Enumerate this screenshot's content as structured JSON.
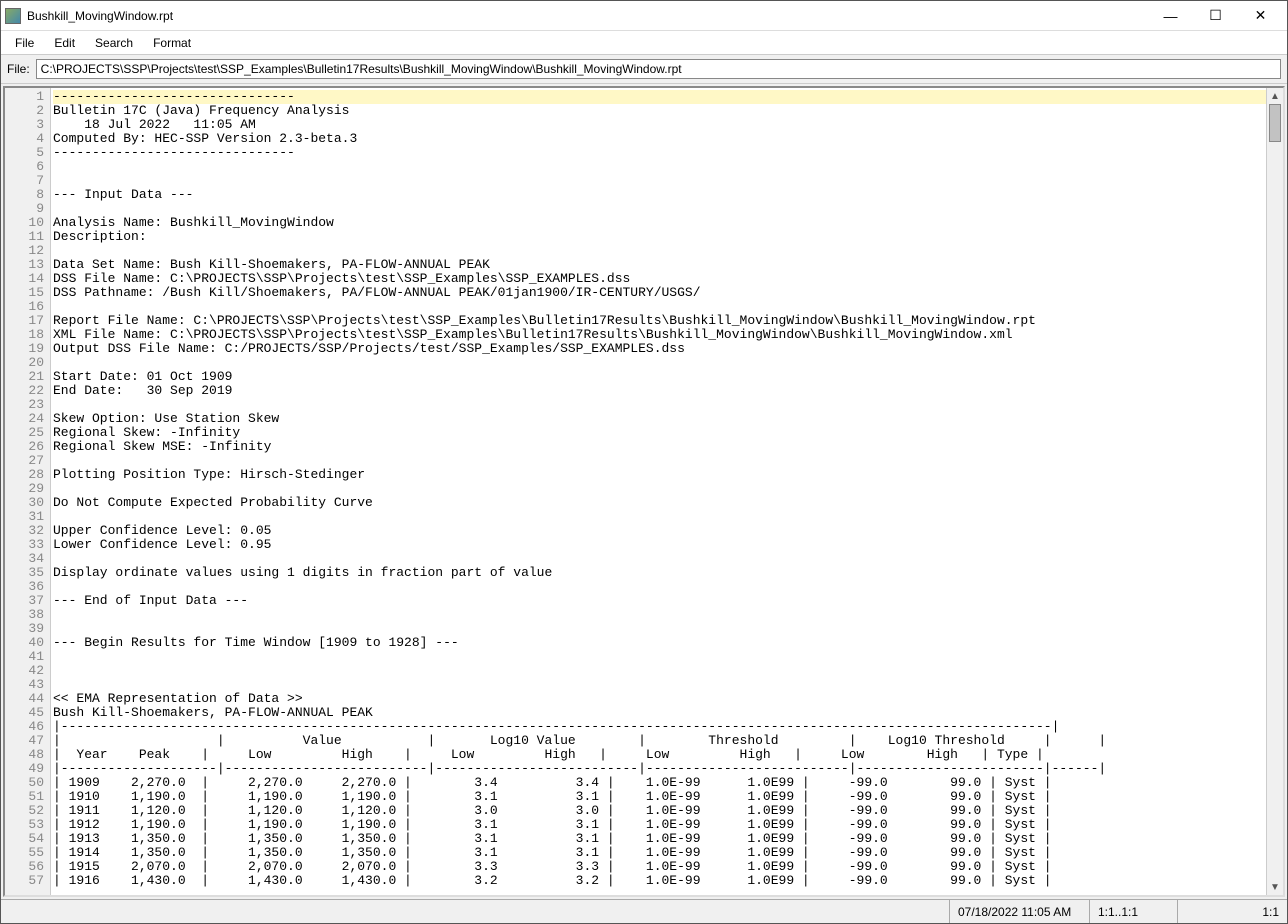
{
  "window": {
    "title": "Bushkill_MovingWindow.rpt"
  },
  "menu": {
    "file": "File",
    "edit": "Edit",
    "search": "Search",
    "format": "Format"
  },
  "filebar": {
    "label": "File:",
    "path": "C:\\PROJECTS\\SSP\\Projects\\test\\SSP_Examples\\Bulletin17Results\\Bushkill_MovingWindow\\Bushkill_MovingWindow.rpt"
  },
  "statusbar": {
    "datetime": "07/18/2022 11:05 AM",
    "selection": "1:1..1:1",
    "position": "1:1"
  },
  "lines": [
    "-------------------------------",
    "Bulletin 17C (Java) Frequency Analysis",
    "    18 Jul 2022   11:05 AM",
    "Computed By: HEC-SSP Version 2.3-beta.3",
    "-------------------------------",
    "",
    "",
    "--- Input Data ---",
    "",
    "Analysis Name: Bushkill_MovingWindow",
    "Description: ",
    "",
    "Data Set Name: Bush Kill-Shoemakers, PA-FLOW-ANNUAL PEAK",
    "DSS File Name: C:\\PROJECTS\\SSP\\Projects\\test\\SSP_Examples\\SSP_EXAMPLES.dss",
    "DSS Pathname: /Bush Kill/Shoemakers, PA/FLOW-ANNUAL PEAK/01jan1900/IR-CENTURY/USGS/",
    "",
    "Report File Name: C:\\PROJECTS\\SSP\\Projects\\test\\SSP_Examples\\Bulletin17Results\\Bushkill_MovingWindow\\Bushkill_MovingWindow.rpt",
    "XML File Name: C:\\PROJECTS\\SSP\\Projects\\test\\SSP_Examples\\Bulletin17Results\\Bushkill_MovingWindow\\Bushkill_MovingWindow.xml",
    "Output DSS File Name: C:/PROJECTS/SSP/Projects/test/SSP_Examples/SSP_EXAMPLES.dss",
    "",
    "Start Date: 01 Oct 1909",
    "End Date:   30 Sep 2019",
    "",
    "Skew Option: Use Station Skew",
    "Regional Skew: -Infinity",
    "Regional Skew MSE: -Infinity",
    "",
    "Plotting Position Type: Hirsch-Stedinger",
    "",
    "Do Not Compute Expected Probability Curve",
    "",
    "Upper Confidence Level: 0.05",
    "Lower Confidence Level: 0.95",
    "",
    "Display ordinate values using 1 digits in fraction part of value",
    "",
    "--- End of Input Data ---",
    "",
    "",
    "--- Begin Results for Time Window [1909 to 1928] ---",
    "",
    "",
    "",
    "<< EMA Representation of Data >>",
    "Bush Kill-Shoemakers, PA-FLOW-ANNUAL PEAK",
    "|-------------------------------------------------------------------------------------------------------------------------------|",
    "|                    |          Value           |       Log10 Value        |        Threshold         |    Log10 Threshold     |      |",
    "|  Year    Peak    |     Low         High    |     Low         High   |     Low         High   |     Low        High   | Type |",
    "|--------------------|--------------------------|--------------------------|--------------------------|------------------------|------|",
    "| 1909    2,270.0  |     2,270.0     2,270.0 |        3.4          3.4 |    1.0E-99      1.0E99 |     -99.0        99.0 | Syst |",
    "| 1910    1,190.0  |     1,190.0     1,190.0 |        3.1          3.1 |    1.0E-99      1.0E99 |     -99.0        99.0 | Syst |",
    "| 1911    1,120.0  |     1,120.0     1,120.0 |        3.0          3.0 |    1.0E-99      1.0E99 |     -99.0        99.0 | Syst |",
    "| 1912    1,190.0  |     1,190.0     1,190.0 |        3.1          3.1 |    1.0E-99      1.0E99 |     -99.0        99.0 | Syst |",
    "| 1913    1,350.0  |     1,350.0     1,350.0 |        3.1          3.1 |    1.0E-99      1.0E99 |     -99.0        99.0 | Syst |",
    "| 1914    1,350.0  |     1,350.0     1,350.0 |        3.1          3.1 |    1.0E-99      1.0E99 |     -99.0        99.0 | Syst |",
    "| 1915    2,070.0  |     2,070.0     2,070.0 |        3.3          3.3 |    1.0E-99      1.0E99 |     -99.0        99.0 | Syst |",
    "| 1916    1,430.0  |     1,430.0     1,430.0 |        3.2          3.2 |    1.0E-99      1.0E99 |     -99.0        99.0 | Syst |"
  ]
}
